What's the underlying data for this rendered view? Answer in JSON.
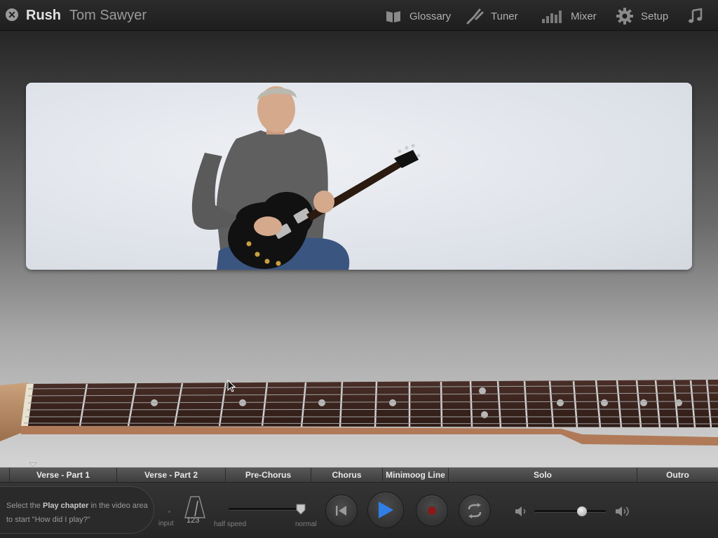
{
  "header": {
    "artist": "Rush",
    "song": "Tom Sawyer",
    "nav": [
      {
        "label": "Glossary",
        "icon": "book-icon"
      },
      {
        "label": "Tuner",
        "icon": "tuning-fork-icon"
      },
      {
        "label": "Mixer",
        "icon": "mixer-icon"
      },
      {
        "label": "Setup",
        "icon": "gear-icon"
      },
      {
        "label": "",
        "icon": "music-notes-icon"
      }
    ]
  },
  "chapters": [
    "Verse - Part 1",
    "Verse - Part 2",
    "Pre-Chorus",
    "Chorus",
    "Minimoog Line",
    "Solo",
    "Outro"
  ],
  "controls": {
    "hint_prefix": "Select the ",
    "hint_bold": "Play chapter",
    "hint_suffix": " in the video area to start \"How did I play?\"",
    "input_label": "input",
    "metronome_label": "123",
    "speed_min_label": "half speed",
    "speed_max_label": "normal",
    "speed_value": 1.0,
    "volume_value": 0.65
  },
  "colors": {
    "accent_play": "#2f7fe6",
    "record": "#8a1a1a"
  }
}
